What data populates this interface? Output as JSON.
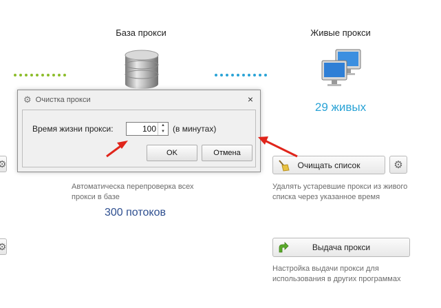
{
  "left_column": {
    "title": "База прокси",
    "description": "Автоматическа перепроверка всех прокси в базе",
    "threads": "300 потоков"
  },
  "right_column": {
    "title": "Живые прокси",
    "alive_count": "29 живых",
    "clear_button_label": "Очищать список",
    "clear_description": "Удалять устаревшие прокси из живого списка через указанное время",
    "issue_button_label": "Выдача прокси",
    "issue_description": "Настройка выдачи прокси для использования в других программах"
  },
  "dialog": {
    "title": "Очистка прокси",
    "close_symbol": "×",
    "field_label": "Время жизни прокси:",
    "field_value": "100",
    "unit_label": "(в минутах)",
    "ok_label": "OK",
    "cancel_label": "Отмена"
  },
  "colors": {
    "green_dots": "#8cbd2b",
    "blue_dots": "#2aa3d6",
    "alive_count": "#2aa3d6",
    "threads": "#2d4e8f",
    "arrow": "#e0251b"
  },
  "icons": {
    "database": "database-icon",
    "monitors": "monitors-icon",
    "broom": "broom-icon",
    "share_arrow": "share-arrow-icon",
    "gear": "gear-icon"
  }
}
